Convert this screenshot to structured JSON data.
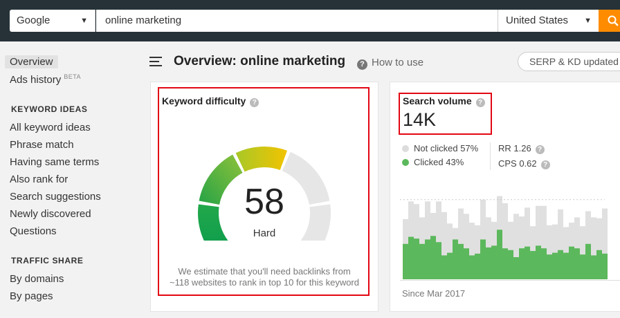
{
  "search_bar": {
    "engine": "Google",
    "query": "online marketing",
    "country": "United States"
  },
  "sidebar": {
    "items_top": [
      {
        "label": "Overview",
        "active": true
      },
      {
        "label": "Ads history",
        "badge": "BETA"
      }
    ],
    "keyword_ideas": {
      "heading": "KEYWORD IDEAS",
      "items": [
        "All keyword ideas",
        "Phrase match",
        "Having same terms",
        "Also rank for",
        "Search suggestions",
        "Newly discovered",
        "Questions"
      ]
    },
    "traffic_share": {
      "heading": "TRAFFIC SHARE",
      "items": [
        "By domains",
        "By pages"
      ]
    }
  },
  "header": {
    "title": "Overview: online marketing",
    "how_to": "How to use",
    "serp_button": "SERP & KD updated"
  },
  "keyword_difficulty": {
    "title": "Keyword difficulty",
    "value": "58",
    "level": "Hard",
    "note_line1": "We estimate that you'll need backlinks from",
    "note_line2": "~118 websites to rank in top 10 for this keyword",
    "gauge_fraction": 0.58
  },
  "search_volume": {
    "title": "Search volume",
    "value": "14K",
    "not_clicked": "Not clicked 57%",
    "clicked": "Clicked 43%",
    "rr": "RR 1.26",
    "cps": "CPS 0.62",
    "since": "Since Mar 2017",
    "colors": {
      "clicked": "#5cb85c",
      "not_clicked": "#e0e0e0"
    }
  },
  "chart_data": {
    "type": "bar",
    "series": [
      {
        "name": "Clicked",
        "values": [
          0.4,
          0.48,
          0.46,
          0.4,
          0.45,
          0.49,
          0.42,
          0.27,
          0.3,
          0.45,
          0.4,
          0.35,
          0.27,
          0.29,
          0.45,
          0.36,
          0.38,
          0.56,
          0.35,
          0.33,
          0.25,
          0.35,
          0.37,
          0.32,
          0.38,
          0.35,
          0.28,
          0.3,
          0.33,
          0.3,
          0.37,
          0.35,
          0.28,
          0.4,
          0.27,
          0.33,
          0.29
        ]
      },
      {
        "name": "Not clicked",
        "values": [
          0.68,
          0.88,
          0.85,
          0.7,
          0.88,
          0.75,
          0.88,
          0.76,
          0.63,
          0.58,
          0.8,
          0.74,
          0.64,
          0.61,
          0.9,
          0.7,
          0.65,
          0.94,
          0.86,
          0.65,
          0.74,
          0.71,
          0.81,
          0.6,
          0.83,
          0.83,
          0.61,
          0.62,
          0.79,
          0.59,
          0.64,
          0.7,
          0.6,
          0.77,
          0.7,
          0.69,
          0.8
        ]
      }
    ],
    "since": "Since Mar 2017"
  },
  "colors": {
    "topbar": "#263238",
    "accent": "#ff8c00",
    "highlight": "#e30613"
  }
}
